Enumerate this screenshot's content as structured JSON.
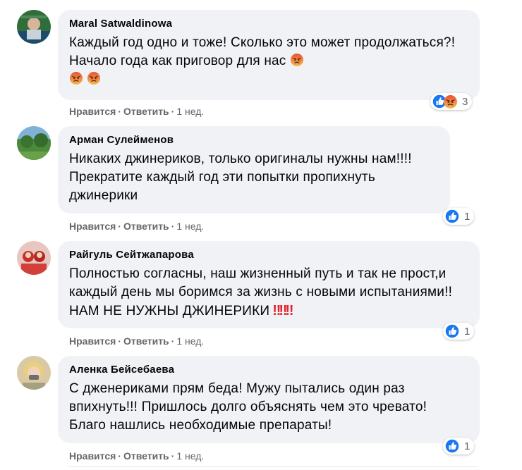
{
  "comments": [
    {
      "author": "Maral Satwaldinowa",
      "text": "Каждый год одно и тоже! Сколько это может продолжаться?! Начало года как приговор для нас",
      "reaction_count": "3",
      "like_label": "Нравится",
      "reply_label": "Ответить",
      "time": "1 нед."
    },
    {
      "author": "Арман Сулейменов",
      "text": "Никаких джинериков, только оригиналы нужны нам!!!! Прекратите каждый год эти попытки пропихнуть джинерики",
      "reaction_count": "1",
      "like_label": "Нравится",
      "reply_label": "Ответить",
      "time": "1 нед."
    },
    {
      "author": "Райгуль Сейтжапарова",
      "text": "Полностью согласны, наш жизненный путь и так не прост,и каждый день мы боримся за жизнь с новыми испытаниями!!НАМ НЕ НУЖНЫ ДЖИНЕРИКИ",
      "emphasis": "‼‼‼",
      "reaction_count": "1",
      "like_label": "Нравится",
      "reply_label": "Ответить",
      "time": "1 нед."
    },
    {
      "author": "Аленка Бейсебаева",
      "text": "С дженериками прям беда! Мужу пытались один раз впихнуть!!! Пришлось долго объяснять чем это чревато! Благо нашлись необходимые препараты!",
      "reaction_count": "1",
      "like_label": "Нравится",
      "reply_label": "Ответить",
      "time": "1 нед."
    }
  ],
  "icons": {
    "like": "like-icon",
    "angry": "angry-icon"
  },
  "colors": {
    "bubble": "#f0f2f5",
    "like_blue": "#1877f2",
    "meta_gray": "#65676b",
    "angry_orange": "#f4a13a"
  }
}
